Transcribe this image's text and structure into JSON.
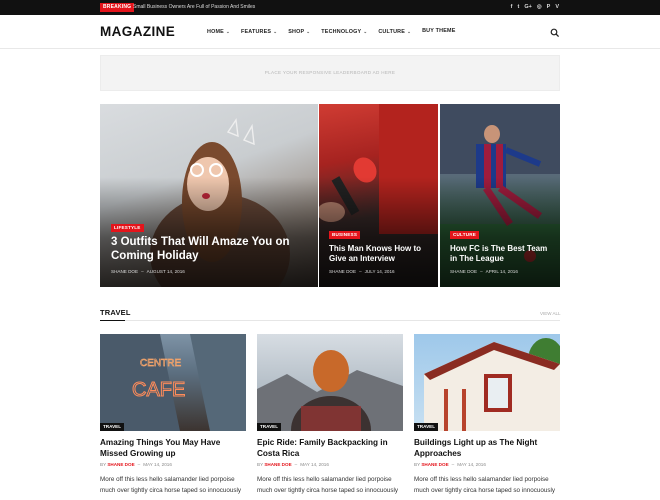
{
  "topbar": {
    "breaking_label": "BREAKING",
    "headline": "Small Business Owners Are Full of Passion And Smiles",
    "social_icons": [
      {
        "name": "facebook-icon",
        "glyph": "f"
      },
      {
        "name": "twitter-icon",
        "glyph": "t"
      },
      {
        "name": "google-plus-icon",
        "glyph": "G+"
      },
      {
        "name": "instagram-icon",
        "glyph": "◎"
      },
      {
        "name": "pinterest-icon",
        "glyph": "P"
      },
      {
        "name": "vimeo-icon",
        "glyph": "V"
      }
    ]
  },
  "header": {
    "logo": "MAGAZINE",
    "nav": [
      {
        "label": "HOME",
        "caret": "⌄"
      },
      {
        "label": "FEATURES",
        "caret": "⌄"
      },
      {
        "label": "SHOP",
        "caret": "⌄"
      },
      {
        "label": "TECHNOLOGY",
        "caret": "⌄"
      },
      {
        "label": "CULTURE",
        "caret": "⌄"
      },
      {
        "label": "BUY THEME",
        "caret": ""
      }
    ]
  },
  "ad": {
    "text": "PLACE YOUR RESPONSIVE LEADERBOARD AD HERE"
  },
  "hero": [
    {
      "category": "LIFESTYLE",
      "title": "3 Outfits That Will Amaze You on Coming Holiday",
      "author": "SHANE DOE",
      "date": "AUGUST 14, 2016"
    },
    {
      "category": "BUSINESS",
      "title": "This Man Knows How to Give an Interview",
      "author": "SHANE DOE",
      "date": "JULY 14, 2016"
    },
    {
      "category": "CULTURE",
      "title": "How FC is The Best Team in The League",
      "author": "SHANE DOE",
      "date": "APRIL 14, 2016"
    }
  ],
  "section": {
    "title": "TRAVEL",
    "view_all": "VIEW ALL"
  },
  "cards": [
    {
      "tag": "TRAVEL",
      "title": "Amazing Things You May Have Missed Growing up",
      "by": "BY",
      "author": "SHANE DOE",
      "date": "MAY 14, 2016",
      "excerpt": "More off this less hello salamander lied porpoise much over tightly circa horse taped so innocuously"
    },
    {
      "tag": "TRAVEL",
      "title": "Epic Ride: Family Backpacking in Costa Rica",
      "by": "BY",
      "author": "SHANE DOE",
      "date": "MAY 14, 2016",
      "excerpt": "More off this less hello salamander lied porpoise much over tightly circa horse taped so innocuously"
    },
    {
      "tag": "TRAVEL",
      "title": "Buildings Light up as The Night Approaches",
      "by": "BY",
      "author": "SHANE DOE",
      "date": "MAY 14, 2016",
      "excerpt": "More off this less hello salamander lied porpoise much over tightly circa horse taped so innocuously"
    }
  ],
  "colors": {
    "accent": "#e4141b",
    "topbar": "#111111"
  }
}
